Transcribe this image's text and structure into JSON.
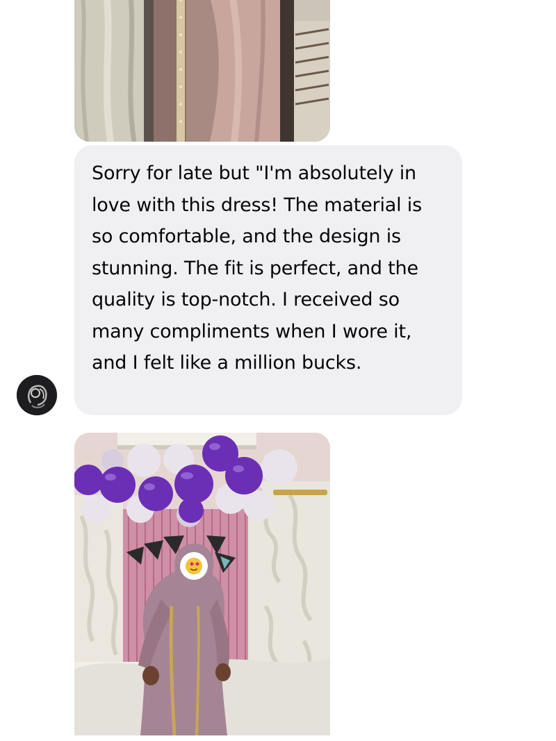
{
  "thread": {
    "incoming_message": {
      "text": "Sorry for late but \"I'm absolutely in love with this dress! The material is so comfortable, and the design is stunning. The fit is perfect, and the quality is top-notch. I received so many compliments when I wore it, and I felt like a million bucks."
    },
    "bubble_color": "#f0f0f3",
    "text_color": "#050505",
    "avatar_icon": "profile-photo-icon",
    "photo_top_icon": "photo-dress-closeup",
    "photo_bottom_icon": "photo-dress-balloons"
  }
}
